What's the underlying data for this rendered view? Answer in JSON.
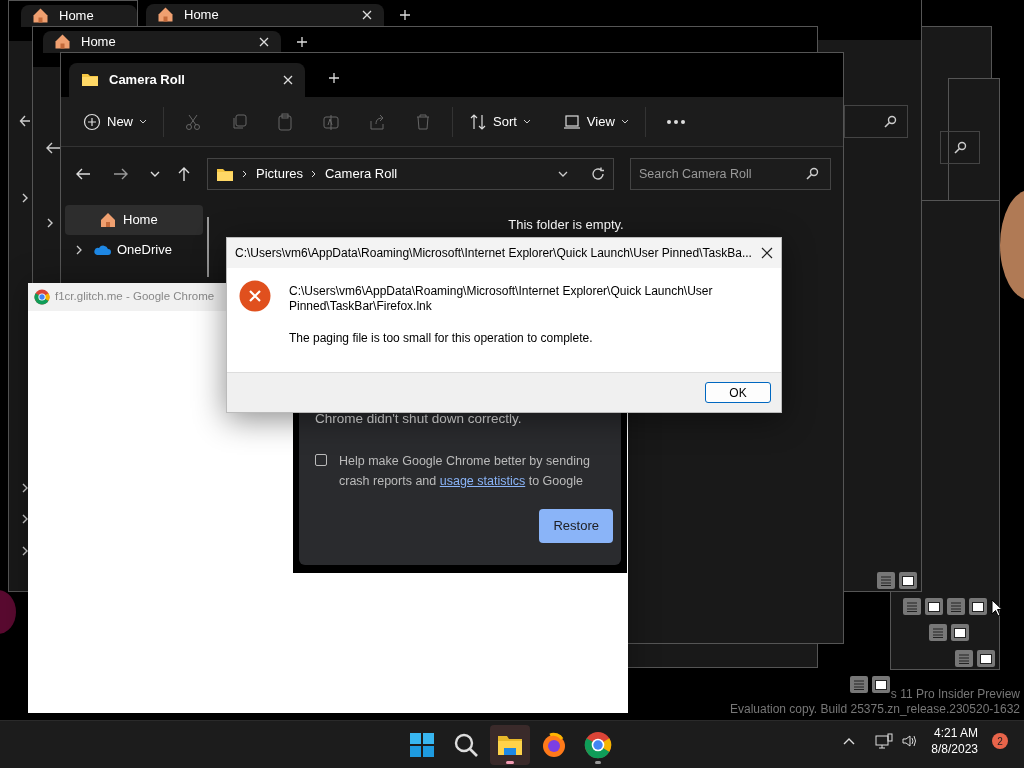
{
  "background_windows": [
    {
      "tab": "Home",
      "closable": false
    },
    {
      "tab": "Home",
      "closable": true
    },
    {
      "tab": "Home",
      "closable": true
    }
  ],
  "explorer": {
    "tab": "Camera Roll",
    "toolbar": {
      "new": "New",
      "sort": "Sort",
      "view": "View"
    },
    "breadcrumb": [
      "Pictures",
      "Camera Roll"
    ],
    "search": {
      "placeholder": "Search Camera Roll"
    },
    "nav_items": [
      {
        "label": "Home",
        "selected": true,
        "expandable": false,
        "kind": "home"
      },
      {
        "label": "OneDrive",
        "selected": false,
        "expandable": true,
        "kind": "cloud"
      }
    ],
    "empty_message": "This folder is empty."
  },
  "chrome_window": {
    "title": "f1cr.glitch.me - Google Chrome"
  },
  "chrome_restore": {
    "message": "Chrome didn't shut down correctly.",
    "checkbox": {
      "checked": false,
      "text_before": "Help make Google Chrome better by sending crash reports and",
      "link": "usage statistics",
      "text_after": "to Google"
    },
    "button": "Restore"
  },
  "error_dialog": {
    "title": "C:\\Users\\vm6\\AppData\\Roaming\\Microsoft\\Internet Explorer\\Quick Launch\\User Pinned\\TaskBa...",
    "path": "C:\\Users\\vm6\\AppData\\Roaming\\Microsoft\\Internet Explorer\\Quick Launch\\User Pinned\\TaskBar\\Firefox.lnk",
    "message": "The paging file is too small for this operation to complete.",
    "button": "OK"
  },
  "watermark": [
    "s 11 Pro Insider Preview",
    "Evaluation copy. Build 25375.zn_release.230520-1632"
  ],
  "taskbar": {
    "apps": [
      {
        "kind": "start",
        "running": false,
        "selected": false
      },
      {
        "kind": "search",
        "running": false,
        "selected": false
      },
      {
        "kind": "explorer",
        "running": true,
        "selected": true
      },
      {
        "kind": "firefox",
        "running": false,
        "selected": false
      },
      {
        "kind": "chrome",
        "running": true,
        "selected": false
      }
    ],
    "time": "4:21 AM",
    "date": "8/8/2023",
    "notification_count": "2"
  }
}
